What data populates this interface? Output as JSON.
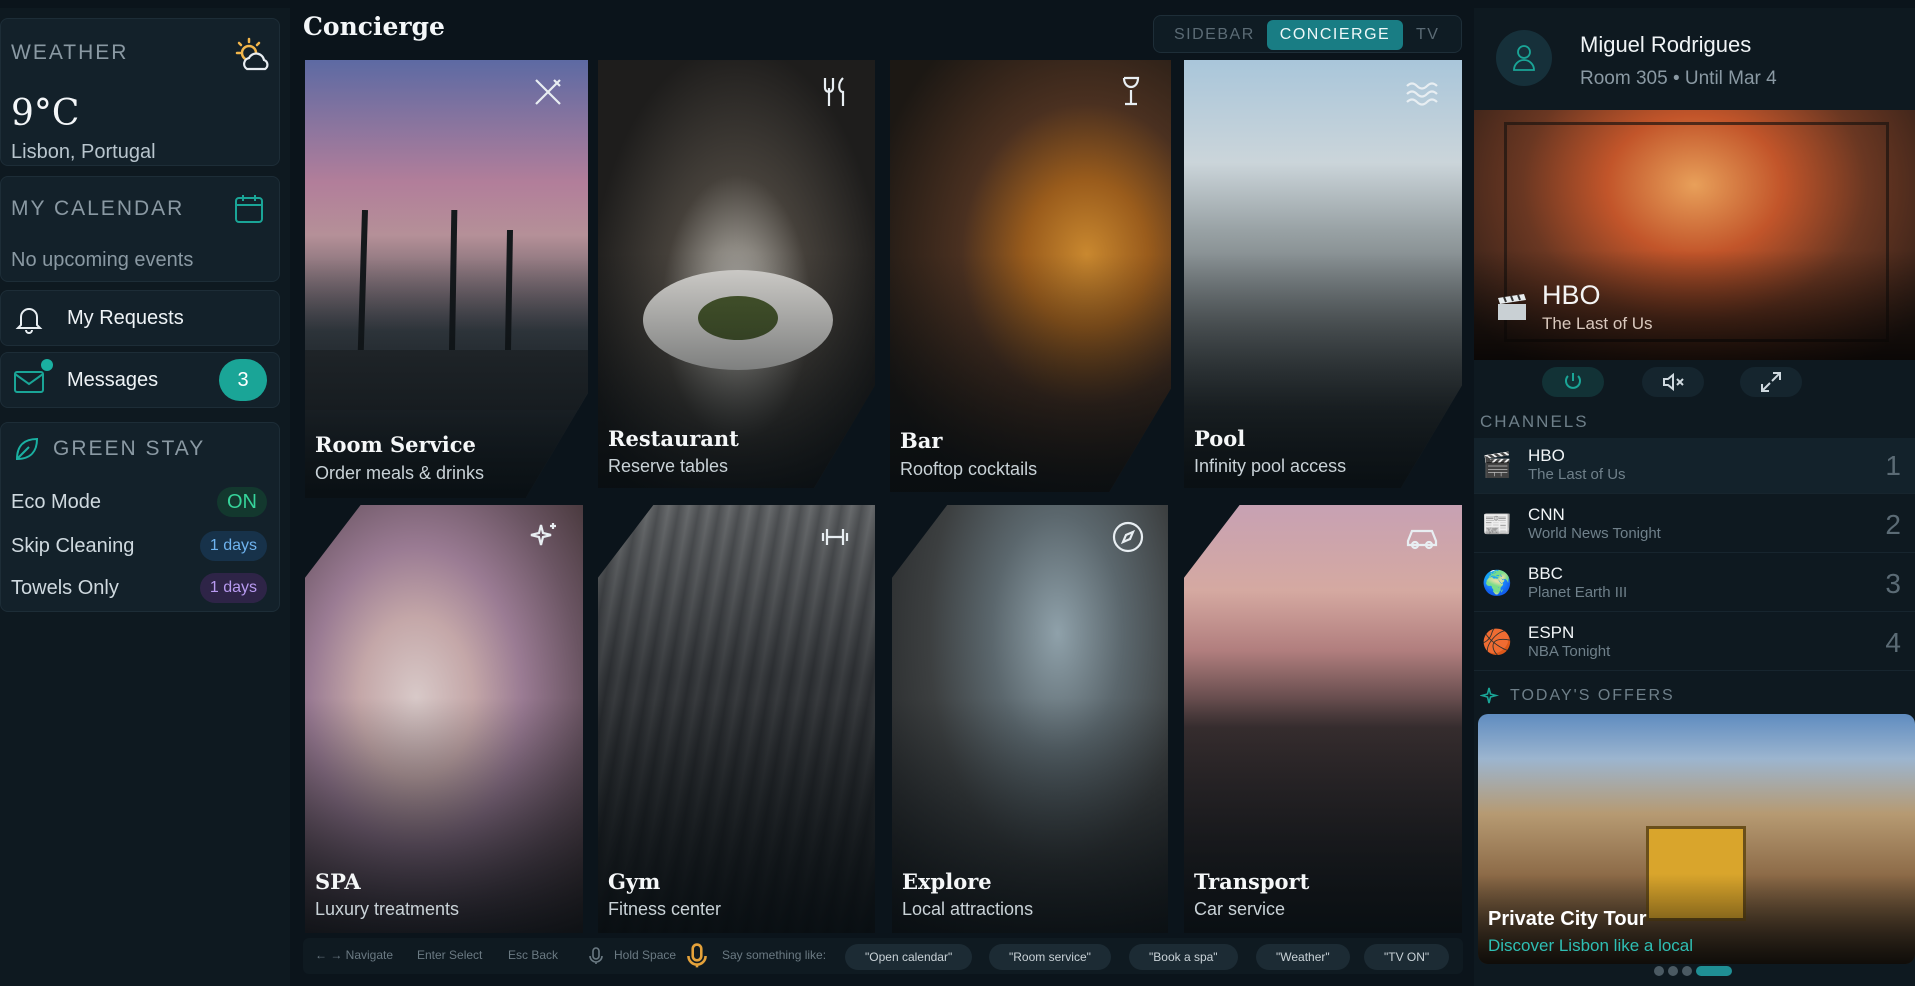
{
  "sidebar": {
    "weather": {
      "label": "WEATHER",
      "temp": "9°C",
      "city": "Lisbon, Portugal"
    },
    "calendar": {
      "label": "MY CALENDAR",
      "empty": "No upcoming events"
    },
    "requests": {
      "label": "My Requests"
    },
    "messages": {
      "label": "Messages",
      "count": "3"
    },
    "green_stay": {
      "label": "GREEN STAY",
      "rows": [
        {
          "key": "Eco Mode",
          "value": "ON"
        },
        {
          "key": "Skip Cleaning",
          "value": "1 days"
        },
        {
          "key": "Towels Only",
          "value": "1 days"
        }
      ]
    }
  },
  "main": {
    "title": "Concierge",
    "modes": [
      "SIDEBAR",
      "CONCIERGE",
      "TV"
    ],
    "active_mode": "CONCIERGE",
    "tiles": [
      {
        "name": "Room Service",
        "sub": "Order meals & drinks",
        "icon": "utensils-icon"
      },
      {
        "name": "Restaurant",
        "sub": "Reserve tables",
        "icon": "fork-knife-icon"
      },
      {
        "name": "Bar",
        "sub": "Rooftop cocktails",
        "icon": "wine-glass-icon"
      },
      {
        "name": "Pool",
        "sub": "Infinity pool access",
        "icon": "waves-icon"
      },
      {
        "name": "SPA",
        "sub": "Luxury treatments",
        "icon": "sparkles-icon"
      },
      {
        "name": "Gym",
        "sub": "Fitness center",
        "icon": "dumbbell-icon"
      },
      {
        "name": "Explore",
        "sub": "Local attractions",
        "icon": "compass-icon"
      },
      {
        "name": "Transport",
        "sub": "Car service",
        "icon": "car-icon"
      }
    ],
    "help": {
      "navigate": "← → Navigate",
      "select": "Enter Select",
      "back": "Esc Back",
      "hold": "Hold Space",
      "say": "Say something like:",
      "suggestions": [
        "\"Open calendar\"",
        "\"Room service\"",
        "\"Book a spa\"",
        "\"Weather\"",
        "\"TV ON\""
      ]
    }
  },
  "right": {
    "guest": {
      "name": "Miguel Rodrigues",
      "room": "Room 305 • Until Mar 4"
    },
    "tv": {
      "channel": "HBO",
      "show": "The Last of Us"
    },
    "channels_label": "CHANNELS",
    "channels": [
      {
        "name": "HBO",
        "show": "The Last of Us",
        "num": "1",
        "icon": "🎬"
      },
      {
        "name": "CNN",
        "show": "World News Tonight",
        "num": "2",
        "icon": "📰"
      },
      {
        "name": "BBC",
        "show": "Planet Earth III",
        "num": "3",
        "icon": "🌍"
      },
      {
        "name": "ESPN",
        "show": "NBA Tonight",
        "num": "4",
        "icon": "🏀"
      }
    ],
    "offers_label": "TODAY'S OFFERS",
    "offer": {
      "title": "Private City Tour",
      "subtitle": "Discover Lisbon like a local"
    }
  },
  "colors": {
    "accent": "#1aa597",
    "background": "#0b141b",
    "panel": "#13212a"
  }
}
